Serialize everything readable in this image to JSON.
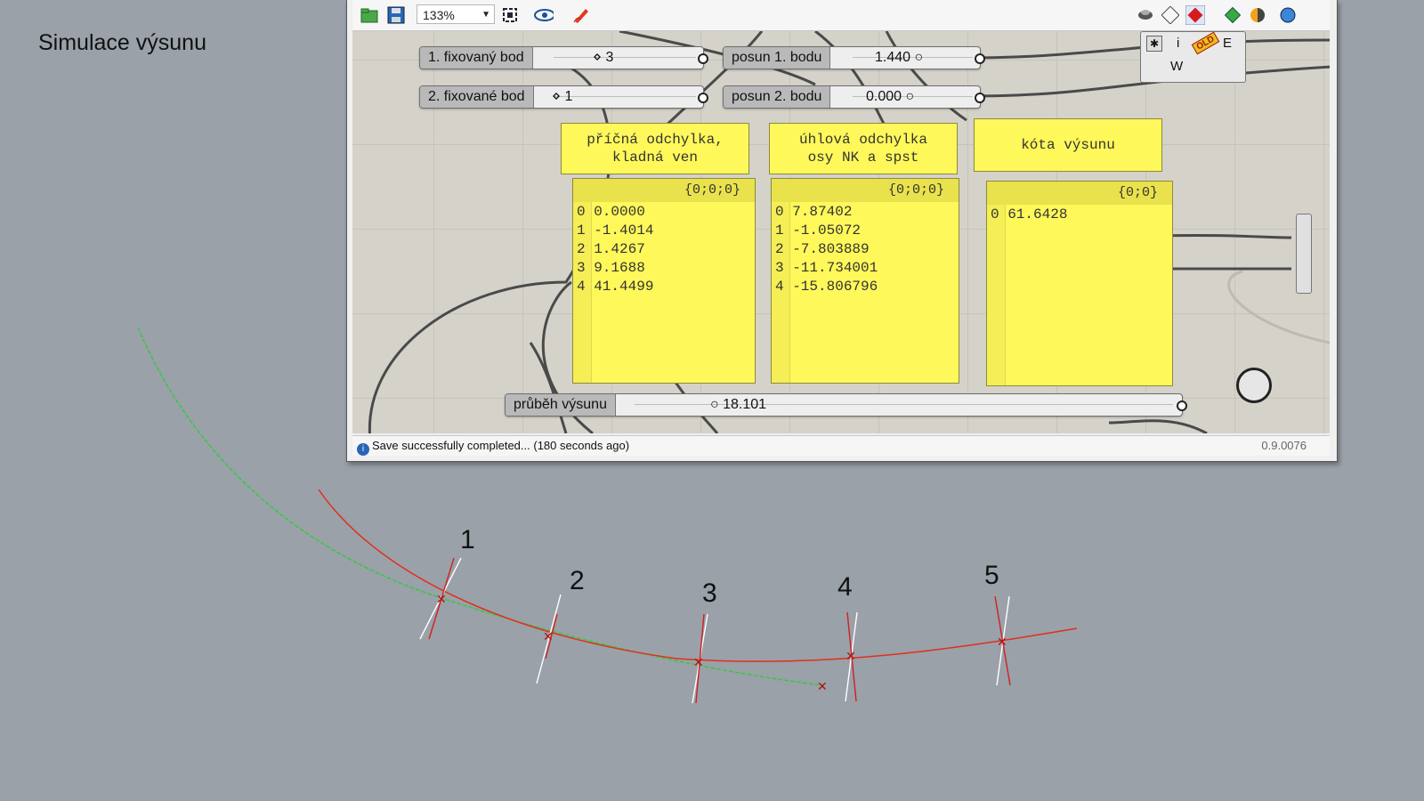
{
  "viewport": {
    "title": "Simulace výsunu"
  },
  "toolbar": {
    "zoom": "133%",
    "icons": [
      "open-file-icon",
      "save-icon",
      "zoom-extents-icon",
      "preview-eye-icon",
      "sketch-pen-icon",
      "render-preview-icon",
      "wireframe-icon",
      "shaded-icon",
      "bake-icon",
      "colour-icon",
      "sphere-icon"
    ]
  },
  "sliders": [
    {
      "name": "fixed-point-1",
      "label": "1. fixovaný bod",
      "value": "3"
    },
    {
      "name": "fixed-point-2",
      "label": "2. fixované bod",
      "value": "1"
    },
    {
      "name": "shift-1",
      "label": "posun 1. bodu",
      "value": "1.440"
    },
    {
      "name": "shift-2",
      "label": "posun 2. bodu",
      "value": "0.000"
    },
    {
      "name": "extrusion-progress",
      "label": "průběh výsunu",
      "value": "18.101"
    }
  ],
  "notes": [
    {
      "text": "příčná odchylka,\nkladná ven"
    },
    {
      "text": "úhlová odchylka\nosy NK a spst"
    },
    {
      "text": "kóta výsunu"
    }
  ],
  "panels": [
    {
      "path": "{0;0;0}",
      "rows": [
        "0 0.0000",
        "1 -1.4014",
        "2 1.4267",
        "3 9.1688",
        "4 41.4499"
      ]
    },
    {
      "path": "{0;0;0}",
      "rows": [
        "0 7.87402",
        "1 -1.05072",
        "2 -7.803889",
        "3 -11.734001",
        "4 -15.806796"
      ]
    },
    {
      "path": "{0;0}",
      "rows": [
        "0 61.6428"
      ]
    }
  ],
  "cluster": {
    "i": "i",
    "e": "E",
    "w": "W",
    "badge": "OLD"
  },
  "status": {
    "message": "Save successfully completed... (180 seconds ago)",
    "version": "0.9.0076"
  },
  "stations": [
    "1",
    "2",
    "3",
    "4",
    "5"
  ]
}
